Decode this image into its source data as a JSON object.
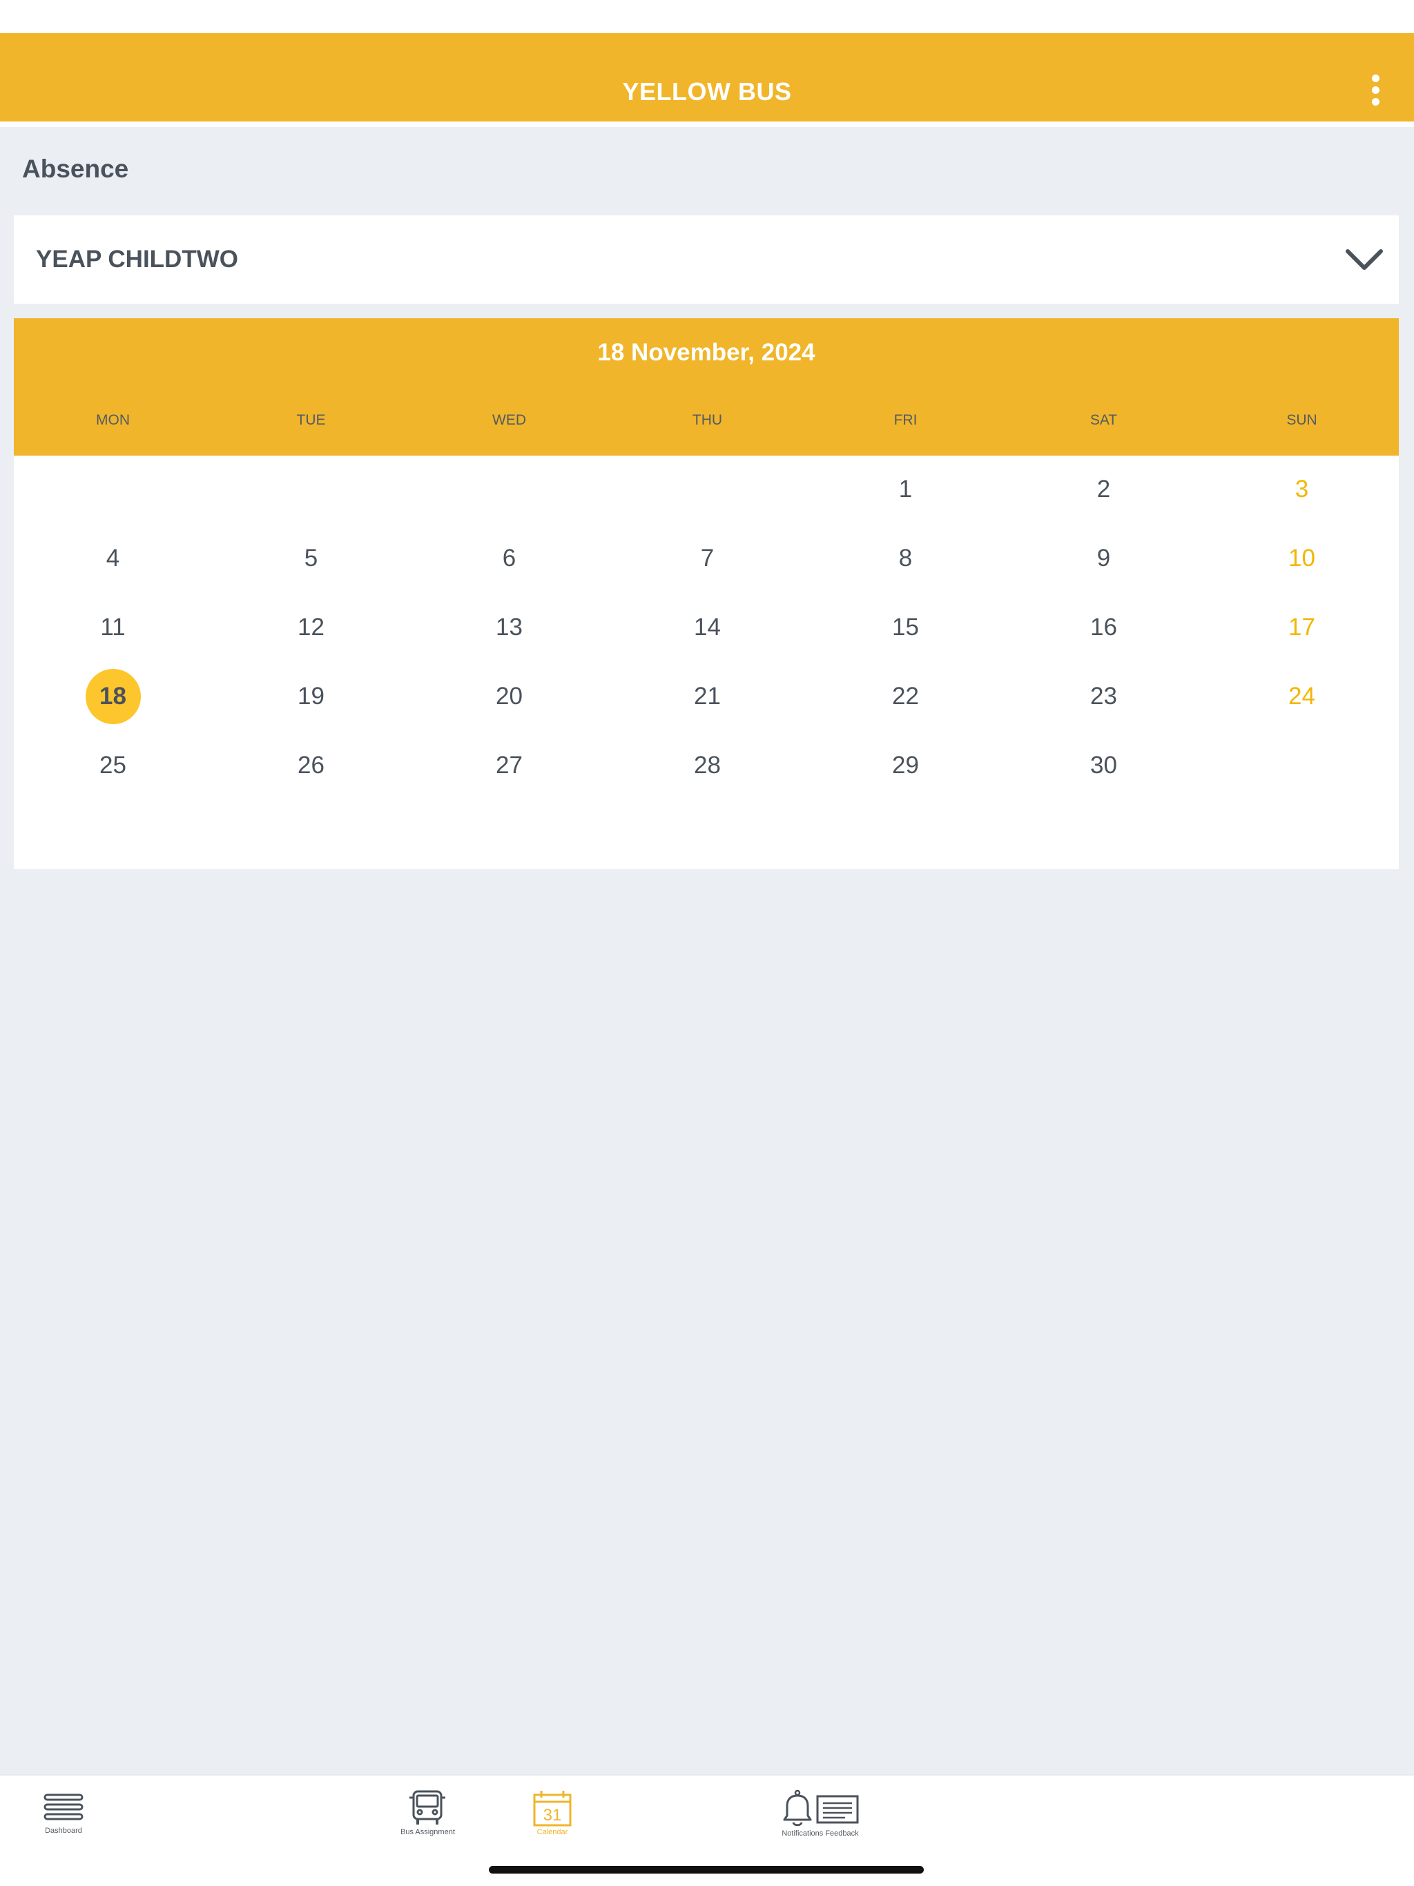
{
  "header": {
    "title": "YELLOW BUS",
    "more_icon": "more-vertical-icon"
  },
  "page": {
    "title": "Absence"
  },
  "child_select": {
    "value": "YEAP CHILDTWO",
    "icon": "chevron-down-icon"
  },
  "calendar": {
    "month_label": "18 November, 2024",
    "weekdays": [
      "MON",
      "TUE",
      "WED",
      "THU",
      "FRI",
      "SAT",
      "SUN"
    ],
    "selected_day": "18",
    "weekend_color": "#f2b705",
    "accent_color": "#f0b52a",
    "weeks": [
      [
        "",
        "",
        "",
        "",
        "1",
        "2",
        "3"
      ],
      [
        "4",
        "5",
        "6",
        "7",
        "8",
        "9",
        "10"
      ],
      [
        "11",
        "12",
        "13",
        "14",
        "15",
        "16",
        "17"
      ],
      [
        "18",
        "19",
        "20",
        "21",
        "22",
        "23",
        "24"
      ],
      [
        "25",
        "26",
        "27",
        "28",
        "29",
        "30",
        ""
      ]
    ]
  },
  "bottom_nav": {
    "active": "Calendar",
    "items": [
      {
        "label": "Dashboard",
        "icon": "menu-icon"
      },
      {
        "label": "Bus Assignment",
        "icon": "bus-icon"
      },
      {
        "label": "Calendar",
        "icon": "calendar-icon",
        "icon_text": "31"
      },
      {
        "label": "Notifications Feedback",
        "icon": "bell-feedback-icon"
      }
    ]
  }
}
